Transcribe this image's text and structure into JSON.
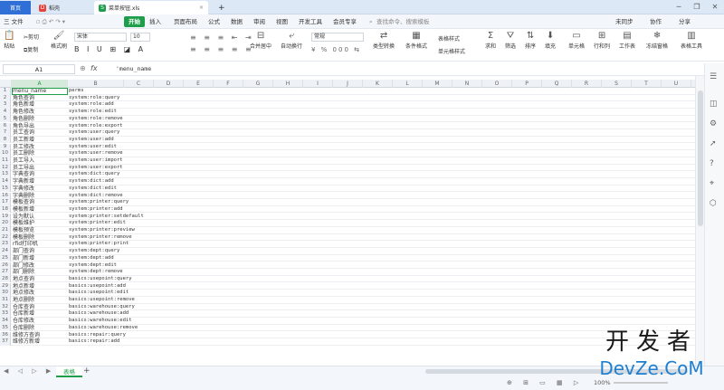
{
  "titlebar": {
    "home": "首页",
    "tab1": "稻壳",
    "tab2": "菜单按钮.xls",
    "plus": "+"
  },
  "menubar": {
    "file": "三 文件",
    "start": "开始",
    "items": [
      "插入",
      "页面布局",
      "公式",
      "数据",
      "审阅",
      "视图",
      "开发工具",
      "会员专享"
    ],
    "search": "查找命令、搜索模板",
    "sync": "未同步",
    "collab": "协作",
    "share": "分享"
  },
  "ribbon": {
    "paste": "粘贴",
    "cut": "剪切",
    "copy": "复制",
    "format_painter": "格式刷",
    "font": "宋体",
    "size": "10",
    "merge": "合并居中",
    "wrap": "自动换行",
    "numfmt": "常规",
    "typeconv": "类型转换",
    "condfmt": "条件格式",
    "tablestyle": "表格样式",
    "cellstyle": "单元格样式",
    "sum": "求和",
    "filter": "筛选",
    "sort": "排序",
    "fill": "填充",
    "cell": "单元格",
    "rowcol": "行和列",
    "sheet": "工作表",
    "freeze": "冻结窗格",
    "tabletools": "表格工具"
  },
  "formulabar": {
    "cell_ref": "A1",
    "fx": "fx",
    "content": "'menu_name"
  },
  "columns": [
    "A",
    "B",
    "C",
    "D",
    "E",
    "F",
    "G",
    "H",
    "I",
    "J",
    "K",
    "L",
    "M",
    "N",
    "O",
    "P",
    "Q",
    "R",
    "S",
    "T",
    "U",
    "V"
  ],
  "rows": [
    [
      "menu_name",
      "perms"
    ],
    [
      "角色查询",
      "system:role:query"
    ],
    [
      "角色新增",
      "system:role:add"
    ],
    [
      "角色修改",
      "system:role:edit"
    ],
    [
      "角色删除",
      "system:role:remove"
    ],
    [
      "角色导出",
      "system:role:export"
    ],
    [
      "员工查询",
      "system:user:query"
    ],
    [
      "员工新增",
      "system:user:add"
    ],
    [
      "员工修改",
      "system:user:edit"
    ],
    [
      "员工删除",
      "system:user:remove"
    ],
    [
      "员工导入",
      "system:user:import"
    ],
    [
      "员工导出",
      "system:user:export"
    ],
    [
      "字典查询",
      "system:dict:query"
    ],
    [
      "字典新增",
      "system:dict:add"
    ],
    [
      "字典修改",
      "system:dict:edit"
    ],
    [
      "字典删除",
      "system:dict:remove"
    ],
    [
      "模板查询",
      "system:printer:query"
    ],
    [
      "模板新增",
      "system:printer:add"
    ],
    [
      "设为默认",
      "system:printer:setdefault"
    ],
    [
      "模板维护",
      "system:printer:edit"
    ],
    [
      "模板预览",
      "system:printer:preview"
    ],
    [
      "模板删除",
      "system:printer:remove"
    ],
    [
      "rfid打印机",
      "system:printer:print"
    ],
    [
      "部门查询",
      "system:dept:query"
    ],
    [
      "部门新增",
      "system:dept:add"
    ],
    [
      "部门修改",
      "system:dept:edit"
    ],
    [
      "部门删除",
      "system:dept:remove"
    ],
    [
      "地点查询",
      "basics:usepoint:query"
    ],
    [
      "地点新增",
      "basics:usepoint:add"
    ],
    [
      "地点修改",
      "basics:usepoint:edit"
    ],
    [
      "地点删除",
      "basics:usepoint:remove"
    ],
    [
      "仓库查询",
      "basics:warehouse:query"
    ],
    [
      "仓库新增",
      "basics:warehouse:add"
    ],
    [
      "仓库修改",
      "basics:warehouse:edit"
    ],
    [
      "仓库删除",
      "basics:warehouse:remove"
    ],
    [
      "维修方查询",
      "basics:repair:query"
    ],
    [
      "维修方新增",
      "basics:repair:add"
    ]
  ],
  "sheet_tab": "表格",
  "add_sheet": "+",
  "zoom": "100%",
  "watermark": {
    "line1": "开发者",
    "line2": "DevZe.CoM"
  },
  "colors": {
    "accent": "#1e9e4a",
    "selection": "#1e9e4a"
  }
}
